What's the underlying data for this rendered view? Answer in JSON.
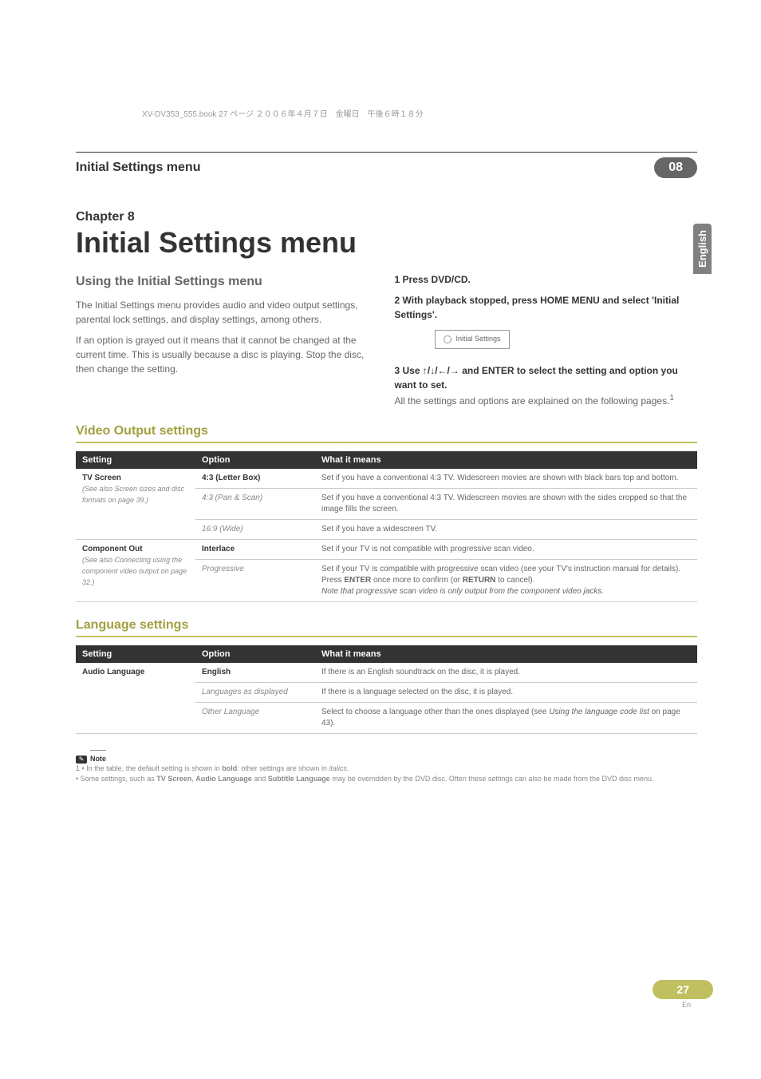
{
  "top_text": "XV-DV353_555.book  27 ページ  ２００６年４月７日　金曜日　午後６時１８分",
  "header": {
    "title": "Initial Settings menu",
    "badge": "08"
  },
  "side_tab": "English",
  "chapter": {
    "label": "Chapter 8",
    "title": "Initial Settings menu"
  },
  "left_col": {
    "heading": "Using the Initial Settings menu",
    "p1": "The Initial Settings menu provides audio and video output settings, parental lock settings, and display settings, among others.",
    "p2": "If an option is grayed out it means that it cannot be changed at the current time. This is usually because a disc is playing. Stop the disc, then change the setting."
  },
  "right_col": {
    "step1": "1    Press DVD/CD.",
    "step2": "2    With playback stopped, press HOME MENU and select 'Initial Settings'.",
    "box_label": "Initial Settings",
    "step3a": "3    Use ",
    "step3_arrows": "↑/↓/←/→",
    "step3b": " and ENTER to select the setting and option you want to set.",
    "p3": "All the settings and options are explained on the following pages.",
    "sup": "1"
  },
  "video_section": {
    "title": "Video Output settings",
    "th1": "Setting",
    "th2": "Option",
    "th3": "What it means",
    "rows": [
      {
        "setting_main": "TV Screen",
        "setting_sub": "(See also Screen sizes and disc formats on page 39.)",
        "option": "4:3 (Letter Box)",
        "option_style": "bold",
        "meaning": "Set if you have a conventional 4:3 TV. Widescreen movies are shown with black bars top and bottom.",
        "rowspan": 3
      },
      {
        "option": "4:3 (Pan & Scan)",
        "option_style": "italic",
        "meaning": "Set if you have a conventional 4:3 TV. Widescreen movies are shown with the sides cropped so that the image fills the screen."
      },
      {
        "option": "16:9 (Wide)",
        "option_style": "italic",
        "meaning": "Set if you have a widescreen TV."
      },
      {
        "setting_main": "Component Out",
        "setting_sub": "(See also Connecting using the component video output on page 32.)",
        "option": "Interlace",
        "option_style": "bold",
        "meaning": "Set if your TV is not compatible with progressive scan video.",
        "rowspan": 2
      },
      {
        "option": "Progressive",
        "option_style": "italic",
        "meaning_pre": "Set if your TV is compatible with progressive scan video (see your TV's instruction manual for details). Press ",
        "meaning_bold1": "ENTER",
        "meaning_mid": " once more to confirm (or ",
        "meaning_bold2": "RETURN",
        "meaning_post": " to cancel).",
        "meaning_italic": "Note that progressive scan video is only output from the component video jacks."
      }
    ]
  },
  "language_section": {
    "title": "Language settings",
    "th1": "Setting",
    "th2": "Option",
    "th3": "What it means",
    "rows": [
      {
        "setting_main": "Audio Language",
        "option": "English",
        "option_style": "bold",
        "meaning": "If there is an English soundtrack on the disc, it is played.",
        "rowspan": 3
      },
      {
        "option": "Languages as displayed",
        "option_style": "italic",
        "meaning": "If there is a language selected on the disc, it is played."
      },
      {
        "option": "Other Language",
        "option_style": "italic",
        "meaning_pre": "Select to choose a language other than the ones displayed (see ",
        "meaning_italic": "Using the language code list",
        "meaning_post": " on page 43)."
      }
    ]
  },
  "note": {
    "label": "Note",
    "line1_pre": "1 • In the table, the default setting is shown in ",
    "line1_bold": "bold",
    "line1_mid": ": other settings are shown in ",
    "line1_italic": "italics",
    "line1_post": ".",
    "line2_pre": "• Some settings, such as ",
    "line2_b1": "TV Screen",
    "line2_mid1": ", ",
    "line2_b2": "Audio Language",
    "line2_mid2": " and ",
    "line2_b3": "Subtitle Language",
    "line2_post": " may be overridden by the DVD disc. Often these settings can also be made from the DVD disc menu."
  },
  "page": {
    "number": "27",
    "lang": "En"
  }
}
